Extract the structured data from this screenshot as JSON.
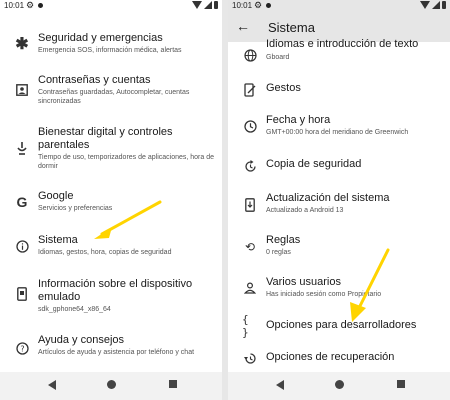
{
  "status": {
    "time": "10:01"
  },
  "left": {
    "items": [
      {
        "title": "Seguridad y emergencias",
        "subtitle": "Emergencia SOS, información médica, alertas",
        "icon": "asterisk-icon"
      },
      {
        "title": "Contraseñas y cuentas",
        "subtitle": "Contraseñas guardadas, Autocompletar, cuentas sincronizadas",
        "icon": "account-box-icon"
      },
      {
        "title": "Bienestar digital y controles parentales",
        "subtitle": "Tiempo de uso, temporizadores de aplicaciones, hora de dormir",
        "icon": "wellbeing-icon"
      },
      {
        "title": "Google",
        "subtitle": "Servicios y preferencias",
        "icon": "google-icon"
      },
      {
        "title": "Sistema",
        "subtitle": "Idiomas, gestos, hora, copias de seguridad",
        "icon": "info-icon"
      },
      {
        "title": "Información sobre el dispositivo emulado",
        "subtitle": "sdk_gphone64_x86_64",
        "icon": "device-icon"
      },
      {
        "title": "Ayuda y consejos",
        "subtitle": "Artículos de ayuda y asistencia por teléfono y chat",
        "icon": "help-icon"
      }
    ]
  },
  "right": {
    "title": "Sistema",
    "items": [
      {
        "title": "Idiomas e introducción de texto",
        "subtitle": "Gboard",
        "icon": "globe-icon"
      },
      {
        "title": "Gestos",
        "subtitle": "",
        "icon": "gesture-icon"
      },
      {
        "title": "Fecha y hora",
        "subtitle": "GMT+00:00 hora del meridiano de Greenwich",
        "icon": "clock-icon"
      },
      {
        "title": "Copia de seguridad",
        "subtitle": "",
        "icon": "backup-icon"
      },
      {
        "title": "Actualización del sistema",
        "subtitle": "Actualizado a Android 13",
        "icon": "system-update-icon"
      },
      {
        "title": "Reglas",
        "subtitle": "0 reglas",
        "icon": "rules-icon"
      },
      {
        "title": "Varios usuarios",
        "subtitle": "Has iniciado sesión como Propietario",
        "icon": "person-icon"
      },
      {
        "title": "Opciones para desarrolladores",
        "subtitle": "",
        "icon": "developer-braces-icon"
      },
      {
        "title": "Opciones de recuperación",
        "subtitle": "",
        "icon": "restore-icon"
      }
    ]
  }
}
